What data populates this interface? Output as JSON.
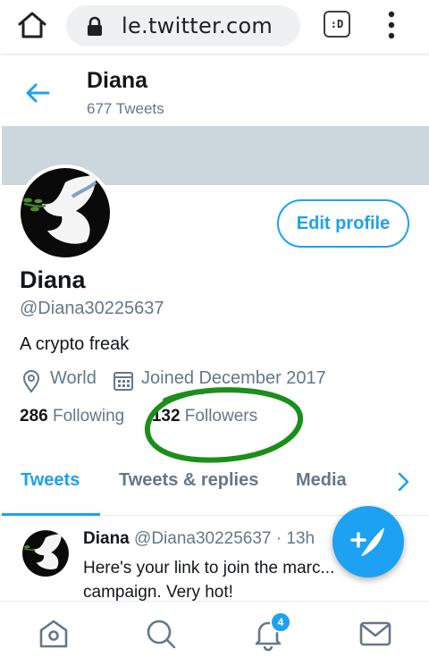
{
  "browser": {
    "url": "le.twitter.com",
    "tab_indicator": ":D",
    "icons": [
      "home-icon",
      "lock-icon",
      "tab-switcher-icon",
      "more-vert-icon"
    ]
  },
  "header": {
    "name": "Diana",
    "tweet_count": "677 Tweets"
  },
  "profile": {
    "edit_label": "Edit profile",
    "name": "Diana",
    "handle": "@Diana30225637",
    "bio": "A crypto freak",
    "location": "World",
    "joined": "Joined December 2017",
    "following_count": "286",
    "following_label": "Following",
    "followers_count": "132",
    "followers_label": "Followers"
  },
  "tabs": [
    {
      "label": "Tweets",
      "active": true
    },
    {
      "label": "Tweets & replies",
      "active": false
    },
    {
      "label": "Media",
      "active": false
    }
  ],
  "tweet": {
    "name": "Diana",
    "handle": "@Diana30225637",
    "separator": "·",
    "time": "13h",
    "text": "Here's your link to join the marc... campaign. Very hot!"
  },
  "nav": {
    "notification_badge": "4",
    "icons": [
      "home-icon",
      "search-icon",
      "notifications-icon",
      "messages-icon"
    ]
  },
  "colors": {
    "accent": "#1da1f2",
    "banner": "#ccd6dd",
    "annotation": "#1b8f1b"
  }
}
